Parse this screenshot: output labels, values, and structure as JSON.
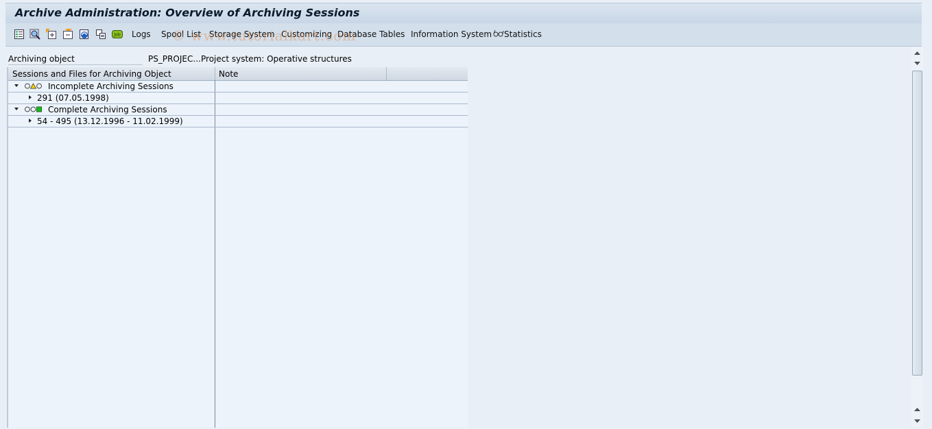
{
  "window": {
    "title": "Archive Administration: Overview of Archiving Sessions"
  },
  "toolbar": {
    "icons": [
      "details-icon",
      "find-icon",
      "expand-subtree-icon",
      "collapse-subtree-icon",
      "refresh-icon",
      "copy-icon",
      "job-icon"
    ],
    "job_icon_text": "Job",
    "buttons": [
      "Logs",
      "Spool List",
      "Storage System",
      "Customizing",
      "Database Tables",
      "Information System",
      "Statistics"
    ]
  },
  "watermark": "© www.tutorialkart.com",
  "archiving_object": {
    "label": "Archiving object",
    "value": "PS_PROJEC...",
    "description": "Project system: Operative structures"
  },
  "tree": {
    "columns": [
      "Sessions and Files for Archiving Object",
      "Note"
    ],
    "nodes": [
      {
        "label": "Incomplete Archiving Sessions",
        "status": "yellow",
        "expanded": true,
        "children": [
          {
            "label": "291 (07.05.1998)",
            "note": ""
          }
        ]
      },
      {
        "label": "Complete Archiving Sessions",
        "status": "green",
        "expanded": true,
        "children": [
          {
            "label": "54 - 495 (13.12.1996 - 11.02.1999)",
            "note": ""
          }
        ]
      }
    ]
  },
  "colors": {
    "status_yellow": "#f0d000",
    "status_green": "#10c010",
    "title_bg": "#cfdcea"
  }
}
